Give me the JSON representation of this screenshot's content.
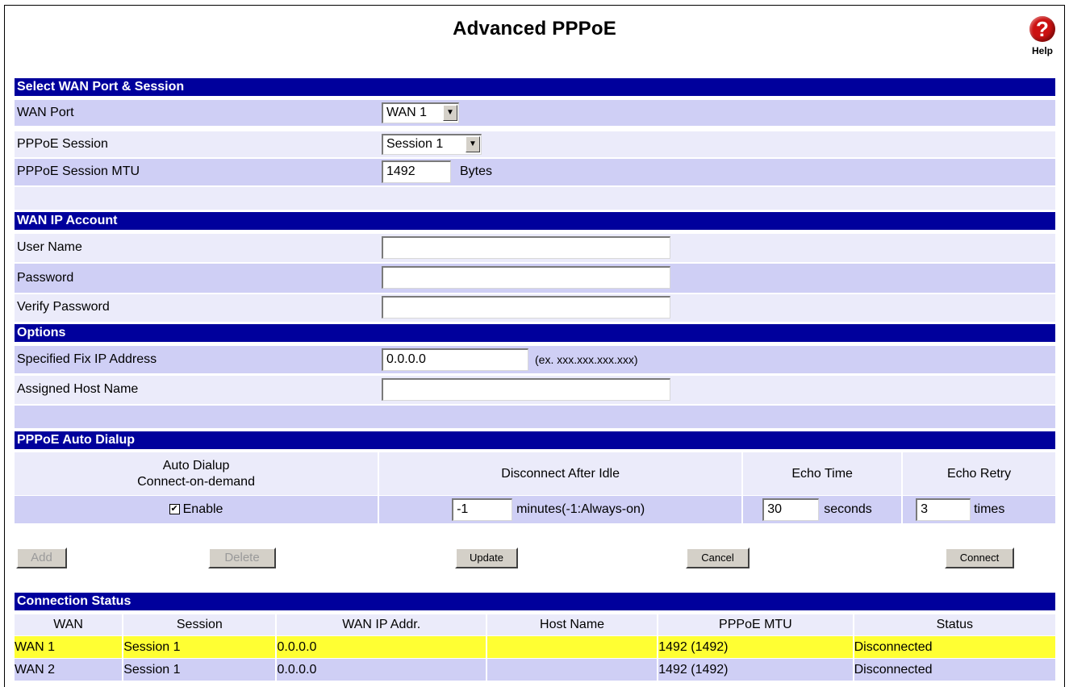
{
  "page": {
    "title": "Advanced PPPoE",
    "help_label": "Help",
    "help_symbol": "?"
  },
  "select_wan": {
    "header": "Select WAN Port & Session",
    "wan_port_label": "WAN Port",
    "wan_port_value": "WAN 1",
    "session_label": "PPPoE Session",
    "session_value": "Session 1",
    "mtu_label": "PPPoE Session MTU",
    "mtu_value": "1492",
    "mtu_unit": "Bytes"
  },
  "account": {
    "header": "WAN IP Account",
    "user_label": "User Name",
    "user_value": "",
    "password_label": "Password",
    "password_value": "",
    "verify_label": "Verify Password",
    "verify_value": ""
  },
  "options": {
    "header": "Options",
    "fix_ip_label": "Specified Fix IP Address",
    "fix_ip_value": "0.0.0.0",
    "fix_ip_hint": "(ex. xxx.xxx.xxx.xxx)",
    "host_label": "Assigned Host Name",
    "host_value": ""
  },
  "auto_dialup": {
    "header": "PPPoE Auto Dialup",
    "col1_line1": "Auto Dialup",
    "col1_line2": "Connect-on-demand",
    "col2": "Disconnect After Idle",
    "col3": "Echo Time",
    "col4": "Echo Retry",
    "enable_label": "Enable",
    "enable_checked": true,
    "idle_value": "-1",
    "idle_unit": "minutes(-1:Always-on)",
    "echo_time_value": "30",
    "echo_time_unit": "seconds",
    "echo_retry_value": "3",
    "echo_retry_unit": "times"
  },
  "buttons": {
    "add": "Add",
    "delete": "Delete",
    "update": "Update",
    "cancel": "Cancel",
    "connect": "Connect"
  },
  "status": {
    "header": "Connection Status",
    "columns": [
      "WAN",
      "Session",
      "WAN IP Addr.",
      "Host Name",
      "PPPoE MTU",
      "Status"
    ],
    "rows": [
      {
        "wan": "WAN 1",
        "session": "Session 1",
        "ip": "0.0.0.0",
        "host": "",
        "mtu": "1492 (1492)",
        "status": "Disconnected"
      },
      {
        "wan": "WAN 2",
        "session": "Session 1",
        "ip": "0.0.0.0",
        "host": "",
        "mtu": "1492 (1492)",
        "status": "Disconnected"
      }
    ]
  },
  "colors": {
    "header_bg": "#00009c",
    "row_shade": "#cfcff5",
    "row_light": "#ebebfa",
    "selected_row": "#ffff33",
    "help_icon": "#cc1111"
  }
}
